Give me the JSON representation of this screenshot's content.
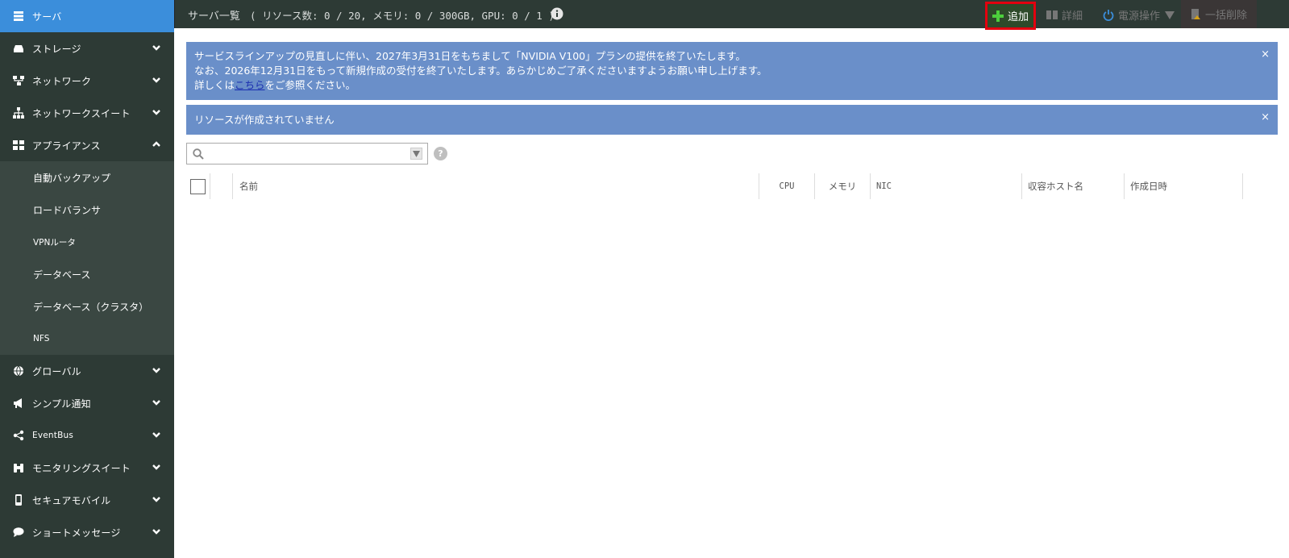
{
  "sidebar": {
    "items": [
      {
        "label": "サーバ",
        "icon": "server-icon",
        "active": true,
        "expandable": false
      },
      {
        "label": "ストレージ",
        "icon": "storage-icon",
        "expandable": true
      },
      {
        "label": "ネットワーク",
        "icon": "network-icon",
        "expandable": true
      },
      {
        "label": "ネットワークスイート",
        "icon": "sitemap-icon",
        "expandable": true
      },
      {
        "label": "アプライアンス",
        "icon": "appliance-icon",
        "expandable": true,
        "expanded": true
      },
      {
        "label": "グローバル",
        "icon": "globe-icon",
        "expandable": true
      },
      {
        "label": "シンプル通知",
        "icon": "megaphone-icon",
        "expandable": true
      },
      {
        "label": "EventBus",
        "icon": "share-icon",
        "expandable": true
      },
      {
        "label": "モニタリングスイート",
        "icon": "binoculars-icon",
        "expandable": true
      },
      {
        "label": "セキュアモバイル",
        "icon": "mobile-icon",
        "expandable": true
      },
      {
        "label": "ショートメッセージ",
        "icon": "chat-icon",
        "expandable": true
      }
    ],
    "appliance_sub": [
      {
        "label": "自動バックアップ"
      },
      {
        "label": "ロードバランサ"
      },
      {
        "label": "VPNルータ"
      },
      {
        "label": "データベース"
      },
      {
        "label": "データベース（クラスタ）"
      },
      {
        "label": "NFS"
      }
    ]
  },
  "topbar": {
    "title": "サーバ一覧",
    "counts": "( リソース数: 0 / 20, メモリ: 0 / 300GB, GPU: 0 / 1 )",
    "add_label": "追加",
    "detail_label": "詳細",
    "power_label": "電源操作",
    "delete_label": "一括削除"
  },
  "alerts": [
    {
      "line1": "サービスラインアップの見直しに伴い、2027年3月31日をもちまして「NVIDIA V100」プランの提供を終了いたします。",
      "line2": "なお、2026年12月31日をもって新規作成の受付を終了いたします。あらかじめご了承くださいますようお願い申し上げます。",
      "line3_prefix": "詳しくは",
      "line3_link": "こちら",
      "line3_suffix": "をご参照ください。",
      "close": "×"
    },
    {
      "text": "リソースが作成されていません",
      "close": "×"
    }
  ],
  "search": {
    "placeholder": "",
    "value": "",
    "help": "?"
  },
  "table": {
    "columns": [
      "名前",
      "CPU",
      "メモリ",
      "NIC",
      "収容ホスト名",
      "作成日時"
    ]
  },
  "colors": {
    "sidebar_bg": "#2d3a35",
    "active_item": "#3b8edb",
    "alert_bg": "#6a8fc9",
    "add_highlight": "#e3000f"
  }
}
